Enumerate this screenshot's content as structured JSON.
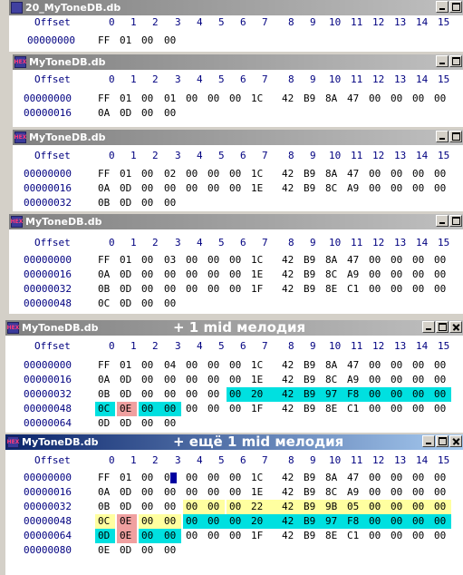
{
  "column_header": {
    "offset_label": "Offset",
    "columns": [
      "0",
      "1",
      "2",
      "3",
      "4",
      "5",
      "6",
      "7",
      "8",
      "9",
      "10",
      "11",
      "12",
      "13",
      "14",
      "15"
    ]
  },
  "windows": [
    {
      "title": "20_MyToneDB.db",
      "note": "",
      "rows": [
        {
          "offset": "00000000",
          "bytes": [
            "FF",
            "01",
            "00",
            "00"
          ]
        }
      ]
    },
    {
      "title": "MyToneDB.db",
      "note": "",
      "rows": [
        {
          "offset": "00000000",
          "bytes": [
            "FF",
            "01",
            "00",
            "01",
            "00",
            "00",
            "00",
            "1C",
            "42",
            "B9",
            "8A",
            "47",
            "00",
            "00",
            "00",
            "00"
          ]
        },
        {
          "offset": "00000016",
          "bytes": [
            "0A",
            "0D",
            "00",
            "00"
          ]
        }
      ]
    },
    {
      "title": "MyToneDB.db",
      "note": "",
      "rows": [
        {
          "offset": "00000000",
          "bytes": [
            "FF",
            "01",
            "00",
            "02",
            "00",
            "00",
            "00",
            "1C",
            "42",
            "B9",
            "8A",
            "47",
            "00",
            "00",
            "00",
            "00"
          ]
        },
        {
          "offset": "00000016",
          "bytes": [
            "0A",
            "0D",
            "00",
            "00",
            "00",
            "00",
            "00",
            "1E",
            "42",
            "B9",
            "8C",
            "A9",
            "00",
            "00",
            "00",
            "00"
          ]
        },
        {
          "offset": "00000032",
          "bytes": [
            "0B",
            "0D",
            "00",
            "00"
          ]
        }
      ]
    },
    {
      "title": "MyToneDB.db",
      "note": "",
      "rows": [
        {
          "offset": "00000000",
          "bytes": [
            "FF",
            "01",
            "00",
            "03",
            "00",
            "00",
            "00",
            "1C",
            "42",
            "B9",
            "8A",
            "47",
            "00",
            "00",
            "00",
            "00"
          ]
        },
        {
          "offset": "00000016",
          "bytes": [
            "0A",
            "0D",
            "00",
            "00",
            "00",
            "00",
            "00",
            "1E",
            "42",
            "B9",
            "8C",
            "A9",
            "00",
            "00",
            "00",
            "00"
          ]
        },
        {
          "offset": "00000032",
          "bytes": [
            "0B",
            "0D",
            "00",
            "00",
            "00",
            "00",
            "00",
            "1F",
            "42",
            "B9",
            "8E",
            "C1",
            "00",
            "00",
            "00",
            "00"
          ]
        },
        {
          "offset": "00000048",
          "bytes": [
            "0C",
            "0D",
            "00",
            "00"
          ]
        }
      ]
    },
    {
      "title": "MyToneDB.db",
      "note": "+ 1 mid мелодия",
      "rows": [
        {
          "offset": "00000000",
          "bytes": [
            "FF",
            "01",
            "00",
            "04",
            "00",
            "00",
            "00",
            "1C",
            "42",
            "B9",
            "8A",
            "47",
            "00",
            "00",
            "00",
            "00"
          ]
        },
        {
          "offset": "00000016",
          "bytes": [
            "0A",
            "0D",
            "00",
            "00",
            "00",
            "00",
            "00",
            "1E",
            "42",
            "B9",
            "8C",
            "A9",
            "00",
            "00",
            "00",
            "00"
          ]
        },
        {
          "offset": "00000032",
          "bytes": [
            "0B",
            "0D",
            "00",
            "00",
            "00",
            "00",
            "00",
            "20",
            "42",
            "B9",
            "97",
            "F8",
            "00",
            "00",
            "00",
            "00"
          ]
        },
        {
          "offset": "00000048",
          "bytes": [
            "0C",
            "0E",
            "00",
            "00",
            "00",
            "00",
            "00",
            "1F",
            "42",
            "B9",
            "8E",
            "C1",
            "00",
            "00",
            "00",
            "00"
          ]
        },
        {
          "offset": "00000064",
          "bytes": [
            "0D",
            "0D",
            "00",
            "00"
          ]
        }
      ]
    },
    {
      "title": "MyToneDB.db",
      "note": "+ ещё 1 mid мелодия",
      "rows": [
        {
          "offset": "00000000",
          "bytes": [
            "FF",
            "01",
            "00",
            "05",
            "00",
            "00",
            "00",
            "1C",
            "42",
            "B9",
            "8A",
            "47",
            "00",
            "00",
            "00",
            "00"
          ]
        },
        {
          "offset": "00000016",
          "bytes": [
            "0A",
            "0D",
            "00",
            "00",
            "00",
            "00",
            "00",
            "1E",
            "42",
            "B9",
            "8C",
            "A9",
            "00",
            "00",
            "00",
            "00"
          ]
        },
        {
          "offset": "00000032",
          "bytes": [
            "0B",
            "0D",
            "00",
            "00",
            "00",
            "00",
            "00",
            "22",
            "42",
            "B9",
            "9B",
            "05",
            "00",
            "00",
            "00",
            "00"
          ]
        },
        {
          "offset": "00000048",
          "bytes": [
            "0C",
            "0E",
            "00",
            "00",
            "00",
            "00",
            "00",
            "20",
            "42",
            "B9",
            "97",
            "F8",
            "00",
            "00",
            "00",
            "00"
          ]
        },
        {
          "offset": "00000064",
          "bytes": [
            "0D",
            "0E",
            "00",
            "00",
            "00",
            "00",
            "00",
            "1F",
            "42",
            "B9",
            "8E",
            "C1",
            "00",
            "00",
            "00",
            "00"
          ]
        },
        {
          "offset": "00000080",
          "bytes": [
            "0E",
            "0D",
            "00",
            "00"
          ]
        }
      ]
    }
  ],
  "icon_text": "HEX",
  "colors": {
    "highlight_cyan": "#00e0e0",
    "highlight_pink": "#f0a0a0",
    "highlight_yellow": "#ffffa0",
    "cursor": "#0000a0",
    "offset_text": "#000080"
  }
}
